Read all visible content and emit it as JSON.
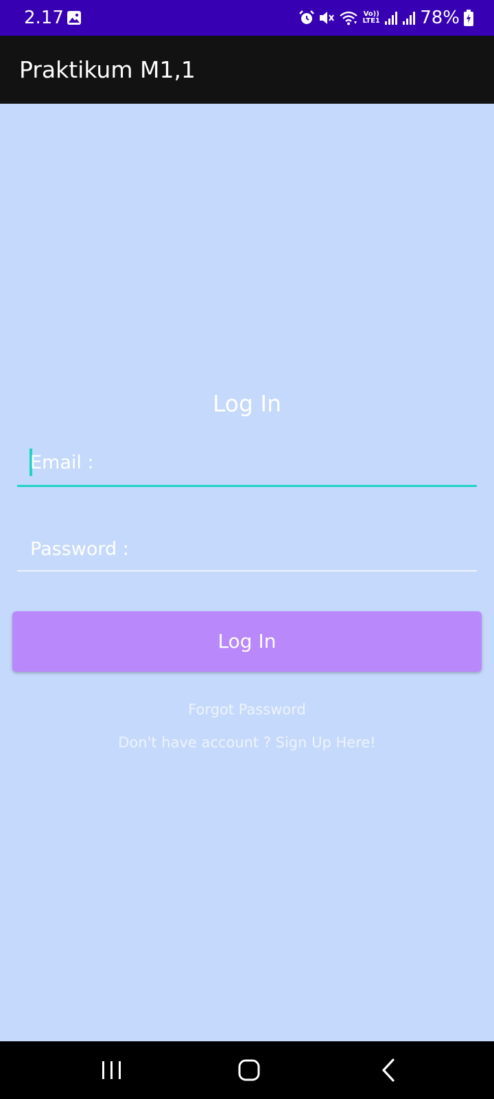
{
  "status_bar": {
    "time": "2.17",
    "battery_percent": "78%",
    "network_label": "Vo)) LTE1",
    "icons": [
      "image-icon",
      "alarm-icon",
      "mute-icon",
      "wifi-icon",
      "volte-icon",
      "signal-icon",
      "signal-icon",
      "battery-charging-icon"
    ],
    "background": "#3700b3"
  },
  "app_bar": {
    "title": "Praktikum M1,1",
    "background": "#121212"
  },
  "login": {
    "heading": "Log In",
    "email_placeholder": "Email :",
    "password_placeholder": "Password :",
    "button_label": "Log In",
    "forgot_password": "Forgot Password",
    "signup_prompt": "Don't have account ? Sign Up Here!"
  },
  "colors": {
    "screen_background": "#c5d9fc",
    "accent": "#1fd3c5",
    "button": "#b988fb"
  },
  "nav_bar": {
    "icons": [
      "recents-icon",
      "home-icon",
      "back-icon"
    ]
  }
}
